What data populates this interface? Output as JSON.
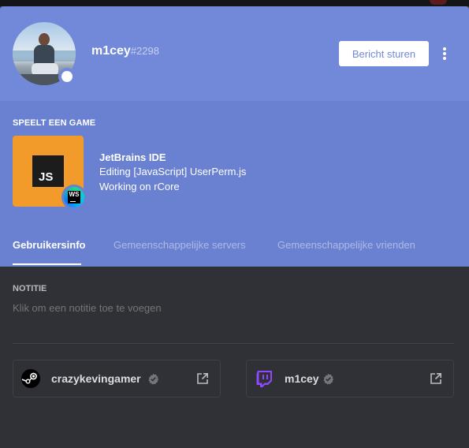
{
  "profile": {
    "username": "m1cey",
    "discriminator": "#2298",
    "status": "online"
  },
  "header": {
    "message_button_label": "Bericht sturen"
  },
  "activity": {
    "section_title": "SPEELT EEN GAME",
    "game_name": "JetBrains IDE",
    "details": "Editing [JavaScript] UserPerm.js",
    "state": "Working on rCore",
    "large_image_text": "JS",
    "small_image_text": "WS"
  },
  "tabs": [
    {
      "label": "Gebruikersinfo",
      "active": true
    },
    {
      "label": "Gemeenschappelijke servers",
      "active": false
    },
    {
      "label": "Gemeenschappelijke vrienden",
      "active": false
    }
  ],
  "note": {
    "title": "NOTITIE",
    "placeholder": "Klik om een notitie toe te voegen"
  },
  "connected_accounts": [
    {
      "service": "steam",
      "name": "crazykevingamer",
      "verified": true
    },
    {
      "service": "twitch",
      "name": "m1cey",
      "verified": true
    }
  ],
  "colors": {
    "blurple": "#7289da",
    "activity_bg": "#6a80d0",
    "body_bg": "#2f3136",
    "game_tile": "#f29b2a",
    "twitch": "#9146ff"
  }
}
